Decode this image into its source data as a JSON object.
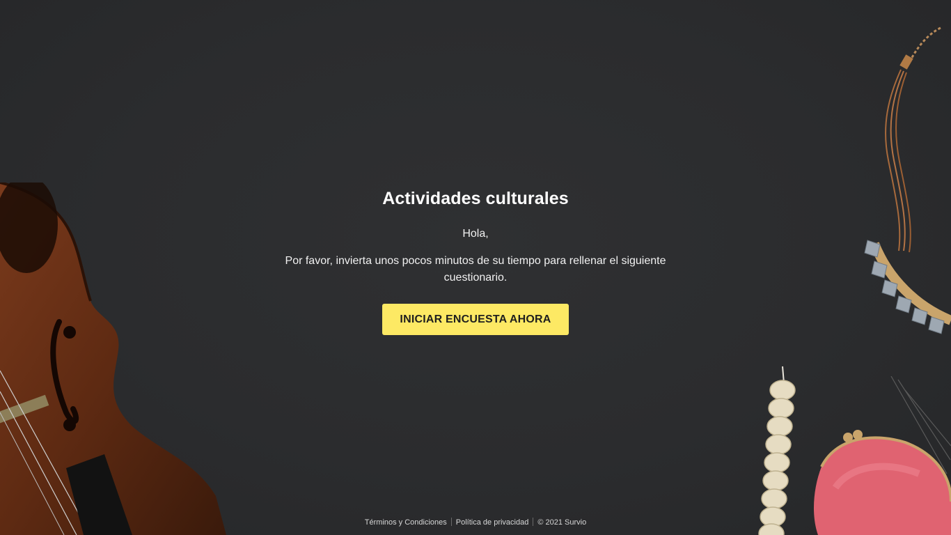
{
  "survey": {
    "title": "Actividades culturales",
    "greeting": "Hola,",
    "intro": "Por favor, invierta unos pocos minutos de su tiempo para rellenar el siguiente cuestionario.",
    "start_label": "INICIAR ENCUESTA AHORA"
  },
  "footer": {
    "terms": "Términos y Condiciones",
    "privacy": "Política de privacidad",
    "copyright": "© 2021 Survio"
  },
  "colors": {
    "background": "#2b2c2e",
    "button": "#fde964",
    "button_text": "#1e1e1e"
  },
  "decorations": [
    "violin-image",
    "necklace-image",
    "candle-image",
    "purse-image"
  ]
}
